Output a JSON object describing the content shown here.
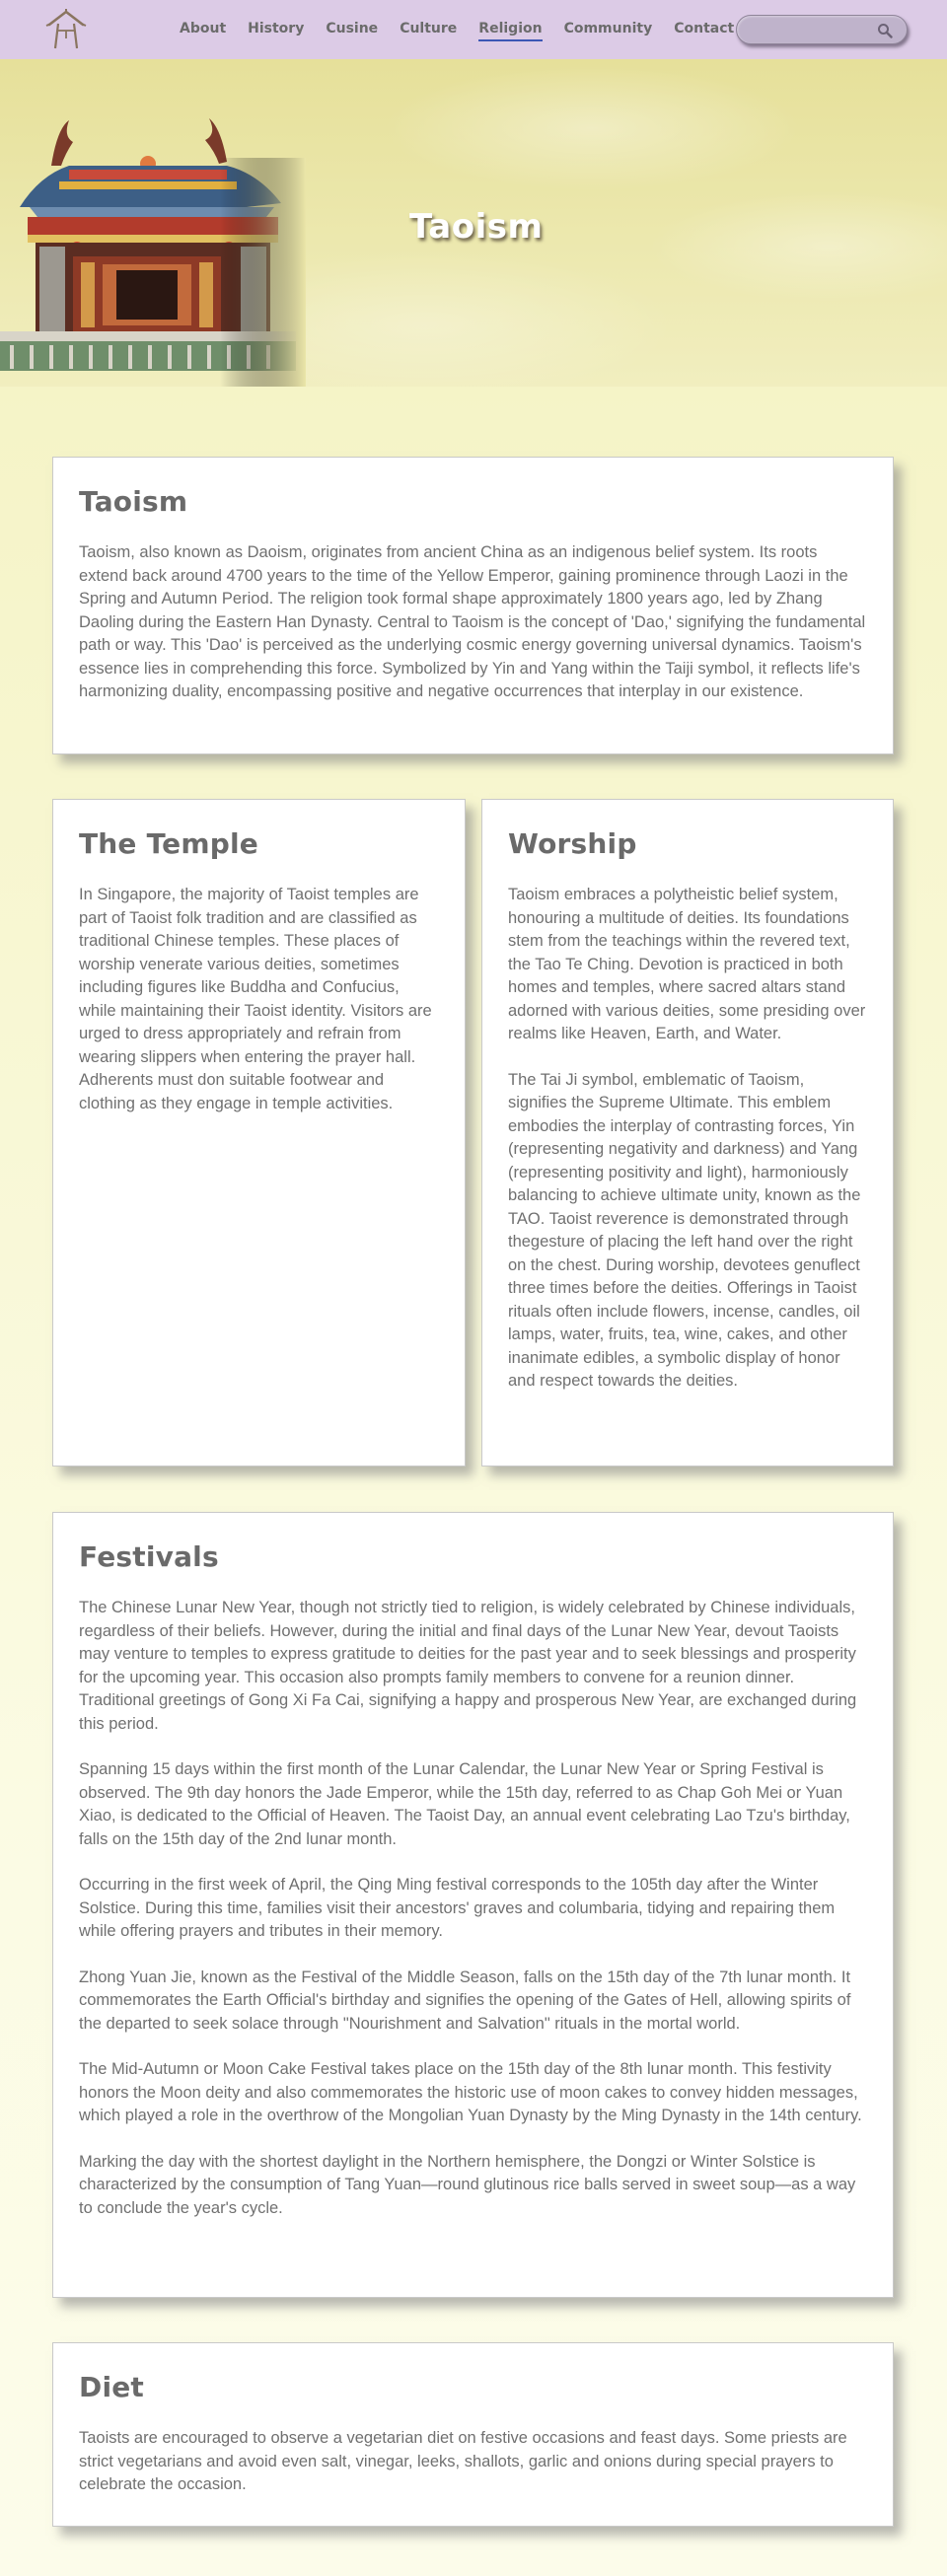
{
  "nav": {
    "logo_icon": "temple-logo-icon",
    "links": [
      "About",
      "History",
      "Cusine",
      "Culture",
      "Religion",
      "Community",
      "Contact"
    ],
    "active": "Religion",
    "search": {
      "value": "",
      "placeholder": "",
      "icon": "search-icon"
    }
  },
  "hero": {
    "title": "Taoism",
    "image": "temple-roof-image"
  },
  "sections": {
    "taoism": {
      "heading": "Taoism",
      "paragraphs": [
        "Taoism, also known as Daoism, originates from ancient China as an indigenous belief system. Its roots extend back around 4700 years to the time of the Yellow Emperor, gaining prominence through Laozi in the Spring and Autumn Period. The religion took formal shape approximately 1800 years ago, led by Zhang Daoling during the Eastern Han Dynasty. Central to Taoism is the concept of 'Dao,' signifying the fundamental path or way. This 'Dao' is perceived as the underlying cosmic energy governing universal dynamics. Taoism's essence lies in comprehending this force. Symbolized by Yin and Yang within the Taiji symbol, it reflects life's harmonizing duality, encompassing positive and negative occurrences that interplay in our existence."
      ]
    },
    "temple": {
      "heading": "The Temple",
      "paragraphs": [
        "In Singapore, the majority of Taoist temples are part of Taoist folk tradition and are classified as traditional Chinese temples. These places of worship venerate various deities, sometimes including figures like Buddha and Confucius, while maintaining their Taoist identity. Visitors are urged to dress appropriately and refrain from wearing slippers when entering the prayer hall. Adherents must don suitable footwear and clothing as they engage in temple activities."
      ]
    },
    "worship": {
      "heading": "Worship",
      "paragraphs": [
        "Taoism embraces a polytheistic belief system, honouring a multitude of deities. Its foundations stem from the teachings within the revered text, the Tao Te Ching. Devotion is practiced in both homes and temples, where sacred altars stand adorned with various deities, some presiding over realms like Heaven, Earth, and Water.",
        "The Tai Ji symbol, emblematic of Taoism, signifies the Supreme Ultimate. This emblem embodies the interplay of contrasting forces, Yin (representing negativity and darkness) and Yang (representing positivity and light), harmoniously balancing to achieve ultimate unity, known as the TAO. Taoist reverence is demonstrated through thegesture of placing the left hand over the right on the chest. During worship, devotees genuflect three times before the deities. Offerings in Taoist rituals often include flowers, incense, candles, oil lamps, water, fruits, tea, wine, cakes, and other inanimate edibles, a symbolic display of honor and respect towards the deities."
      ]
    },
    "festivals": {
      "heading": "Festivals",
      "paragraphs": [
        "The Chinese Lunar New Year, though not strictly tied to religion, is widely celebrated by Chinese individuals, regardless of their beliefs. However, during the initial and final days of the Lunar New Year, devout Taoists may venture to temples to express gratitude to deities for the past year and to seek blessings and prosperity for the upcoming year. This occasion also prompts family members to convene for a reunion dinner. Traditional greetings of Gong Xi Fa Cai, signifying a happy and prosperous New Year, are exchanged during this period.",
        "Spanning 15 days within the first month of the Lunar Calendar, the Lunar New Year or Spring Festival is observed. The 9th day honors the Jade Emperor, while the 15th day, referred to as Chap Goh Mei or Yuan Xiao, is dedicated to the Official of Heaven. The Taoist Day, an annual event celebrating Lao Tzu's birthday, falls on the 15th day of the 2nd lunar month.",
        "Occurring in the first week of April, the Qing Ming festival corresponds to the 105th day after the  Winter Solstice. During this time, families visit their ancestors' graves and columbaria, tidying and repairing them while offering prayers and tributes in their memory.",
        "Zhong Yuan Jie, known as the Festival of the Middle Season, falls on the 15th day of the 7th lunar month. It commemorates the Earth Official's birthday and signifies the opening of the Gates of Hell, allowing spirits of the departed to seek solace through \"Nourishment and Salvation\" rituals in the mortal world.",
        "The Mid-Autumn or Moon Cake Festival takes place on the 15th day of the 8th lunar month. This festivity honors the Moon deity and also commemorates the historic use of moon cakes to convey hidden messages, which played a role in the overthrow of the Mongolian Yuan Dynasty by the Ming Dynasty in the 14th century.",
        "Marking the day with the shortest daylight in the Northern hemisphere, the Dongzi or Winter Solstice is characterized by the consumption of Tang Yuan—round glutinous rice balls served in sweet soup—as a way to conclude the year's cycle."
      ]
    },
    "diet": {
      "heading": "Diet",
      "paragraphs": [
        "Taoists are encouraged to observe a vegetarian diet on festive occasions and feast days. Some priests are strict vegetarians and avoid even salt, vinegar, leeks, shallots, garlic and onions during special prayers to celebrate the occasion."
      ]
    }
  },
  "colors": {
    "nav_bg": "#dccbe6",
    "active_underline": "#3b57b5",
    "page_bg": "#f7f6cf",
    "card_bg": "#ffffff",
    "text": "#707070"
  }
}
